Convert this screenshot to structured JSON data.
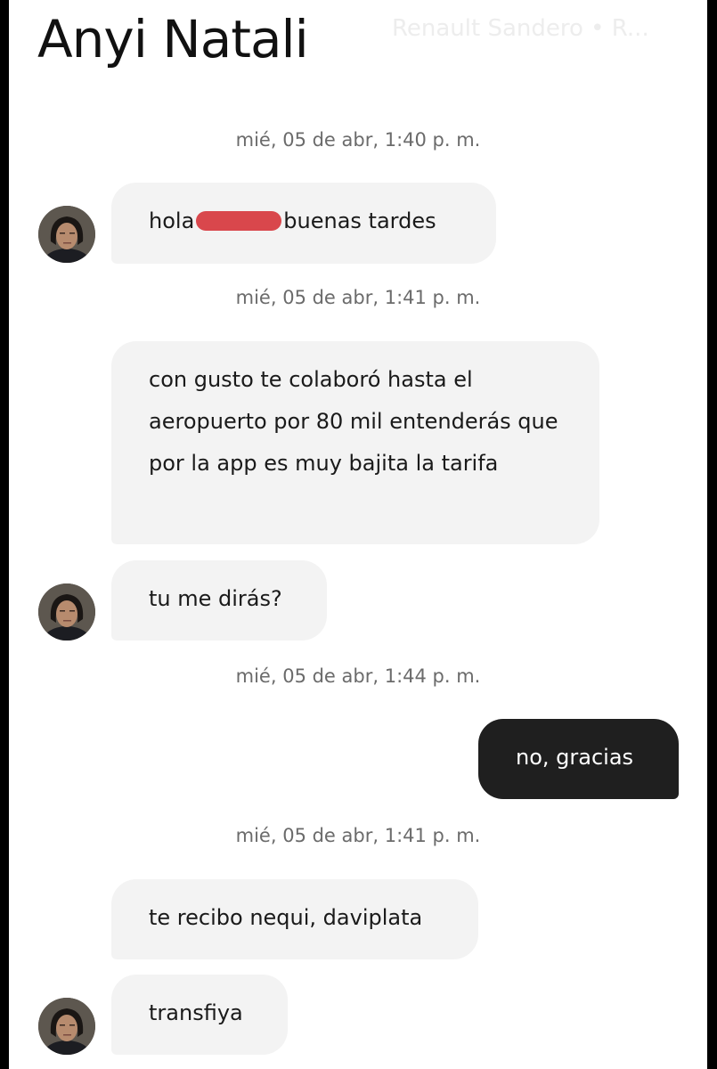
{
  "header": {
    "title": "Anyi Natali",
    "subtitle": "Renault Sandero • R..."
  },
  "messages": [
    {
      "type": "timestamp",
      "text": "mié, 05 de abr, 1:40 p. m."
    },
    {
      "type": "incoming",
      "text_before": "hola",
      "text_after": "buenas tardes",
      "redacted": true
    },
    {
      "type": "timestamp",
      "text": "mié, 05 de abr, 1:41 p. m."
    },
    {
      "type": "incoming",
      "text": "con gusto te colaboró hasta el aeropuerto por 80 mil entenderás que por la app es muy bajita la tarifa"
    },
    {
      "type": "incoming",
      "text": "tu me dirás?"
    },
    {
      "type": "timestamp",
      "text": "mié, 05 de abr, 1:44 p. m."
    },
    {
      "type": "outgoing",
      "text": "no, gracias"
    },
    {
      "type": "timestamp",
      "text": "mié, 05 de abr, 1:41 p. m."
    },
    {
      "type": "incoming",
      "text": "te recibo nequi, daviplata"
    },
    {
      "type": "incoming",
      "text": "transfiya"
    }
  ],
  "colors": {
    "incoming_bubble": "#f3f3f3",
    "outgoing_bubble": "#1f1f1f",
    "redaction": "#d9474c",
    "timestamp": "#6b6b6b"
  }
}
